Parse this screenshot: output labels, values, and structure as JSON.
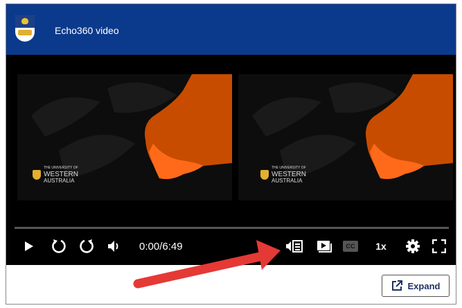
{
  "header": {
    "title": "Echo360 video",
    "logo_icon": "university-crest-icon"
  },
  "video": {
    "panes": [
      {
        "logo_line1": "THE UNIVERSITY OF",
        "logo_line2": "WESTERN",
        "logo_line3": "AUSTRALIA"
      },
      {
        "logo_line1": "THE UNIVERSITY OF",
        "logo_line2": "WESTERN",
        "logo_line3": "AUSTRALIA"
      }
    ],
    "map_color": "#c84c00",
    "highlight_color": "#ff6a1a"
  },
  "controls": {
    "time": "0:00/6:49",
    "progress": 0,
    "cc_label": "CC",
    "speed_label": "1x",
    "icons": [
      "play-icon",
      "rewind-icon",
      "forward-icon",
      "volume-icon",
      "transcript-icon",
      "video-toggle-icon",
      "captions-icon",
      "settings-icon",
      "fullscreen-icon"
    ]
  },
  "footer": {
    "expand_label": "Expand"
  },
  "annotation": {
    "arrow_color": "#e53935"
  },
  "colors": {
    "header_bg": "#0b3a8c",
    "player_bg": "#000000"
  }
}
